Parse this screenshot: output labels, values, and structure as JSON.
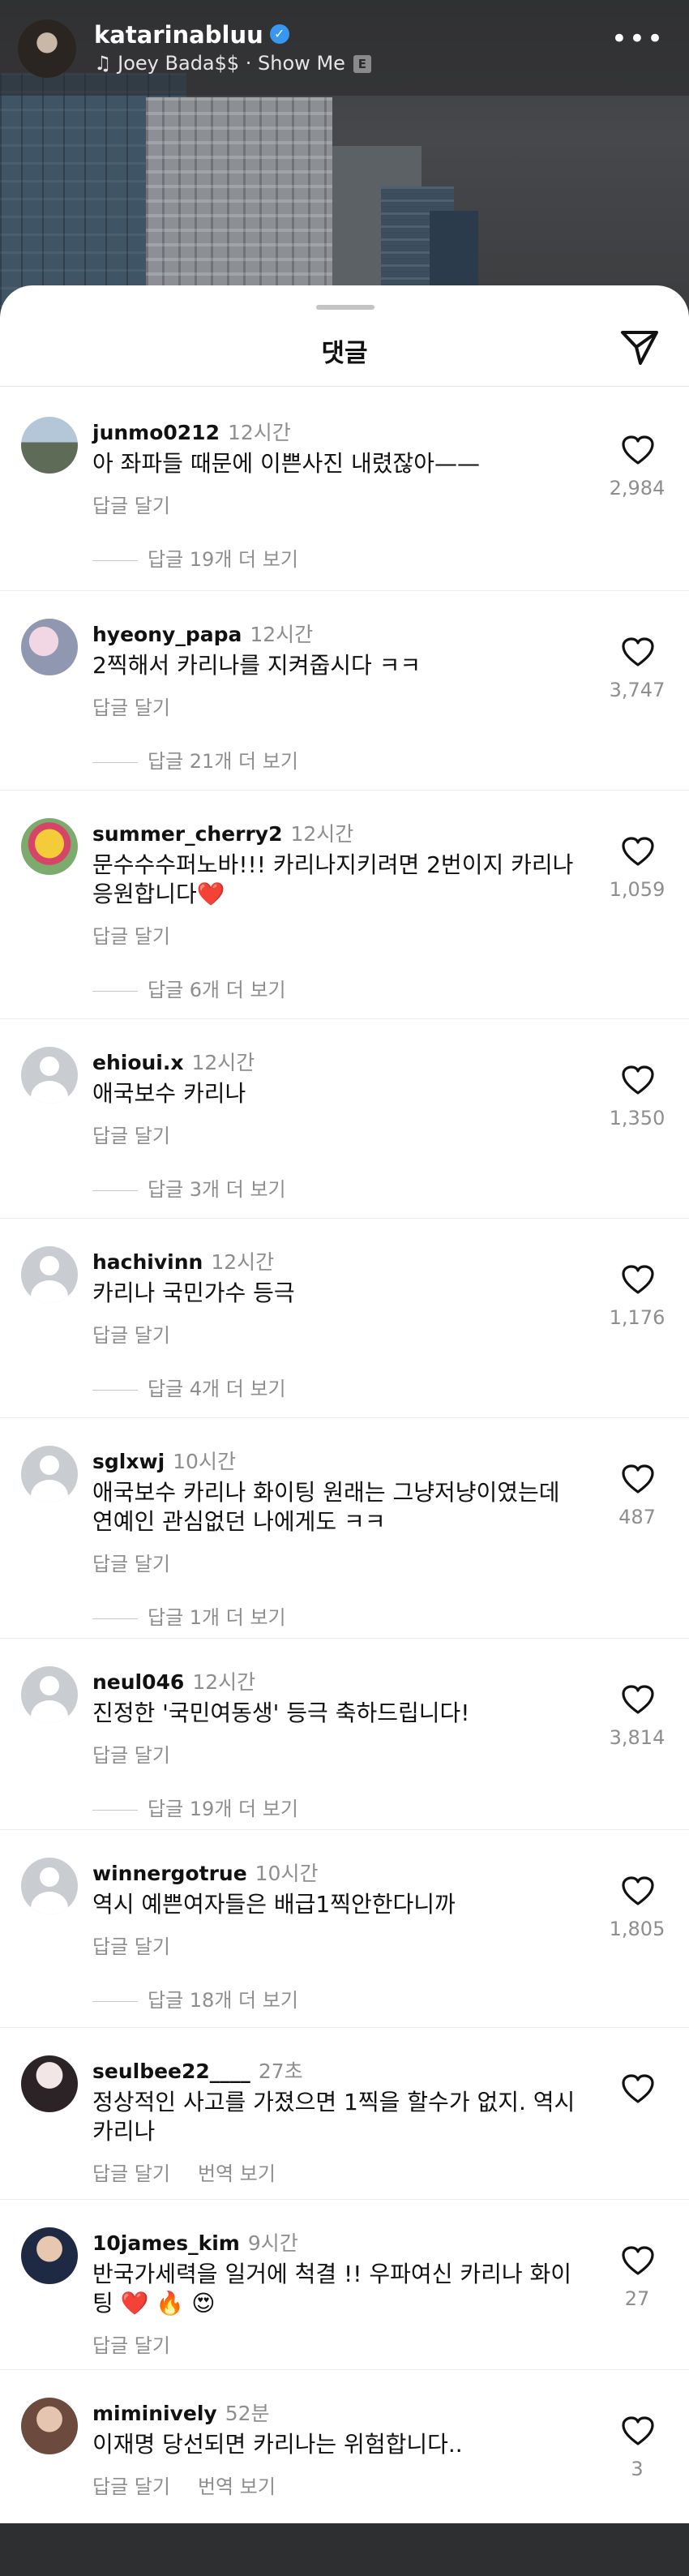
{
  "header": {
    "username": "katarinabluu",
    "music": "Joey Bada$$ · Show Me",
    "explicit_badge": "E",
    "verified": "✓",
    "more": "•••"
  },
  "sheet": {
    "title": "댓글"
  },
  "comments": [
    {
      "username": "junmo0212",
      "time": "12시간",
      "text": "아 좌파들 때문에 이쁜사진 내렸잖아——",
      "reply_label": "답글 달기",
      "translate_label": "",
      "likes": "2,984",
      "view_replies": "답글 19개 더 보기"
    },
    {
      "username": "hyeony_papa",
      "time": "12시간",
      "text": "2찍해서 카리나를 지켜줍시다 ㅋㅋ",
      "reply_label": "답글 달기",
      "translate_label": "",
      "likes": "3,747",
      "view_replies": "답글 21개 더 보기"
    },
    {
      "username": "summer_cherry2",
      "time": "12시간",
      "text": "문수수수퍼노바!!! 카리나지키려면 2번이지 카리나 응원합니다❤️",
      "reply_label": "답글 달기",
      "translate_label": "",
      "likes": "1,059",
      "view_replies": "답글 6개 더 보기"
    },
    {
      "username": "ehioui.x",
      "time": "12시간",
      "text": "애국보수 카리나",
      "reply_label": "답글 달기",
      "translate_label": "",
      "likes": "1,350",
      "view_replies": "답글 3개 더 보기"
    },
    {
      "username": "hachivinn",
      "time": "12시간",
      "text": "카리나 국민가수 등극",
      "reply_label": "답글 달기",
      "translate_label": "",
      "likes": "1,176",
      "view_replies": "답글 4개 더 보기"
    },
    {
      "username": "sglxwj",
      "time": "10시간",
      "text": "애국보수 카리나 화이팅 원래는 그냥저냥이였는데 연예인 관심없던 나에게도 ㅋㅋ",
      "reply_label": "답글 달기",
      "translate_label": "",
      "likes": "487",
      "view_replies": "답글 1개 더 보기"
    },
    {
      "username": "neul046",
      "time": "12시간",
      "text": "진정한 '국민여동생' 등극 축하드립니다!",
      "reply_label": "답글 달기",
      "translate_label": "",
      "likes": "3,814",
      "view_replies": "답글 19개 더 보기"
    },
    {
      "username": "winnergotrue",
      "time": "10시간",
      "text": "역시 예쁜여자들은 배급1찍안한다니까",
      "reply_label": "답글 달기",
      "translate_label": "",
      "likes": "1,805",
      "view_replies": "답글 18개 더 보기"
    },
    {
      "username": "seulbee22____",
      "time": "27초",
      "text": "정상적인 사고를 가졌으면 1찍을 할수가 없지. 역시 카리나",
      "reply_label": "답글 달기",
      "translate_label": "번역 보기",
      "likes": "",
      "view_replies": ""
    },
    {
      "username": "10james_kim",
      "time": "9시간",
      "text": "반국가세력을 일거에 척결 !! 우파여신 카리나 화이팅 ❤️ 🔥 😍",
      "reply_label": "답글 달기",
      "translate_label": "",
      "likes": "27",
      "view_replies": ""
    },
    {
      "username": "miminively",
      "time": "52분",
      "text": "이재명 당선되면 카리나는 위험합니다..",
      "reply_label": "답글 달기",
      "translate_label": "번역 보기",
      "likes": "3",
      "view_replies": ""
    }
  ],
  "icons": {
    "avatar": "avatar-photo",
    "heart": "heart-outline-icon",
    "send": "paper-plane-icon",
    "music": "music-note-icon",
    "more": "more-dots-icon"
  },
  "colors": {
    "text": "#111111",
    "muted": "#8e8e8e",
    "verified": "#3897f0"
  }
}
